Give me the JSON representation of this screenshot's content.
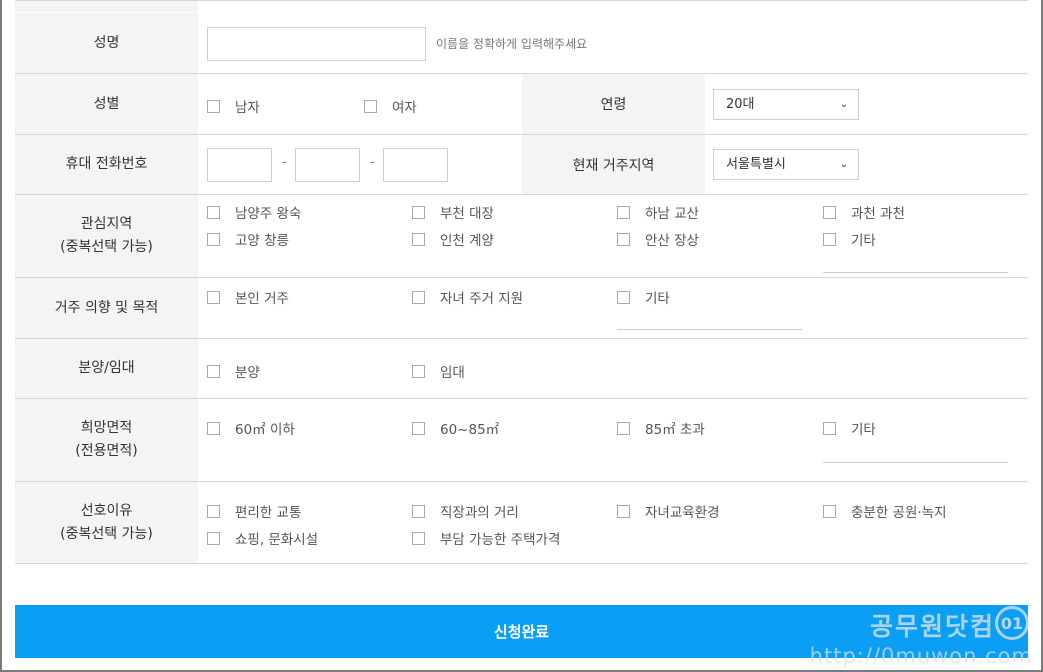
{
  "form": {
    "name": {
      "label": "성명",
      "value": "",
      "hint": "이름을 정확하게 입력해주세요"
    },
    "gender": {
      "label": "성별",
      "options": [
        "남자",
        "여자"
      ]
    },
    "age": {
      "label": "연령",
      "selected": "20대"
    },
    "phone": {
      "label": "휴대 전화번호",
      "sep": "-"
    },
    "residence": {
      "label": "현재 거주지역",
      "selected": "서울특별시"
    },
    "interest_region": {
      "label": "관심지역\n(중복선택 가능)",
      "options": [
        "남양주 왕숙",
        "부천 대장",
        "하남 교산",
        "과천 과천",
        "고양 창릉",
        "인천 계양",
        "안산 장상",
        "기타"
      ]
    },
    "purpose": {
      "label": "거주 의향 및 목적",
      "options": [
        "본인 거주",
        "자녀 주거 지원",
        "기타"
      ]
    },
    "type": {
      "label": "분양/임대",
      "options": [
        "분양",
        "임대"
      ]
    },
    "area": {
      "label": "희망면적\n(전용면적)",
      "options": [
        "60㎡ 이하",
        "60~85㎡",
        "85㎡ 초과",
        "기타"
      ]
    },
    "reason": {
      "label": "선호이유\n(중복선택 가능)",
      "options": [
        "편리한 교통",
        "직장과의 거리",
        "자녀교육환경",
        "충분한 공원·녹지",
        "쇼핑, 문화시설",
        "부담 가능한 주택가격"
      ]
    }
  },
  "submit_label": "신청완료",
  "watermark": {
    "title": "공무원닷컴",
    "url": "http://0muwon.com",
    "logo": "01"
  }
}
